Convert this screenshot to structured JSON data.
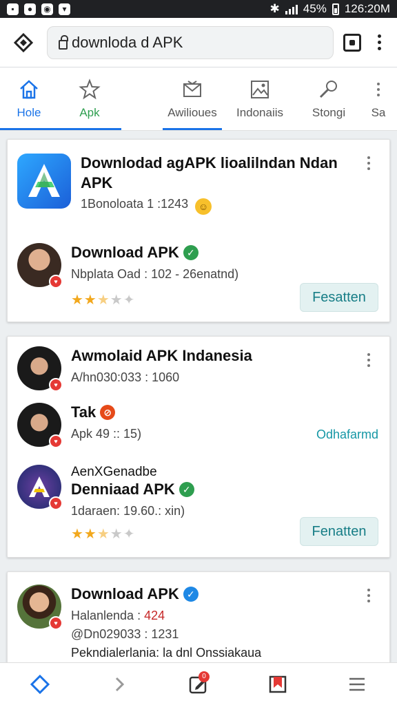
{
  "status_bar": {
    "right_text": "45% ▮ 126:20M",
    "battery": "45%",
    "time": "126:20M"
  },
  "url_bar": {
    "url": "downloda d APK"
  },
  "category_tabs": [
    {
      "label": "Hole",
      "icon": "home-icon",
      "state": "active"
    },
    {
      "label": "Apk",
      "icon": "star-icon",
      "state": "highlight"
    },
    {
      "label": "Awilioues",
      "icon": "mail-icon",
      "state": "selected"
    },
    {
      "label": "Indonaiis",
      "icon": "image-icon",
      "state": "normal"
    },
    {
      "label": "Stongi",
      "icon": "search-icon",
      "state": "normal"
    },
    {
      "label": "Sa",
      "icon": "more-icon",
      "state": "normal"
    }
  ],
  "cards": [
    {
      "header": {
        "title": "Downlodad agAPK lioalilndan Ndan APK",
        "subtitle": "1Bonoloata 1 :1243"
      },
      "item": {
        "title": "Download APK",
        "subtitle": "Nbplata Oad : 102 - 26enatnd)",
        "rating": 3,
        "button": "Fesatten"
      }
    },
    {
      "items": [
        {
          "title": "Awmolaid APK Indanesia",
          "subtitle": "A/hn030:033 : 1060"
        },
        {
          "title": "Tak",
          "subtitle": "Apk 49 :: 15)",
          "action": "Odhafarmd"
        },
        {
          "overline": "AenXGenadbe",
          "title": "Denniaad APK",
          "subtitle": "1daraen: 19.60.: xin)",
          "rating": 3,
          "button": "Fenatten"
        }
      ]
    },
    {
      "item": {
        "title": "Download APK",
        "line1_prefix": "Halanlenda :",
        "line1_value": "424",
        "line2": "@Dn029033 : 1231",
        "line3": "Pekndialerlania: la dnl Onssiakaua"
      }
    }
  ],
  "bottom_nav": [
    {
      "icon": "diamond-home-icon"
    },
    {
      "icon": "forward-icon"
    },
    {
      "icon": "edit-icon",
      "badge": "0"
    },
    {
      "icon": "bookmark-icon"
    },
    {
      "icon": "menu-icon"
    }
  ],
  "colors": {
    "accent_blue": "#1a73e8",
    "accent_green": "#2e9e4f",
    "button_bg": "#e3f1f1",
    "button_text": "#167d86",
    "verified_green": "#2e9e4f",
    "verified_blue": "#1e88e5"
  }
}
